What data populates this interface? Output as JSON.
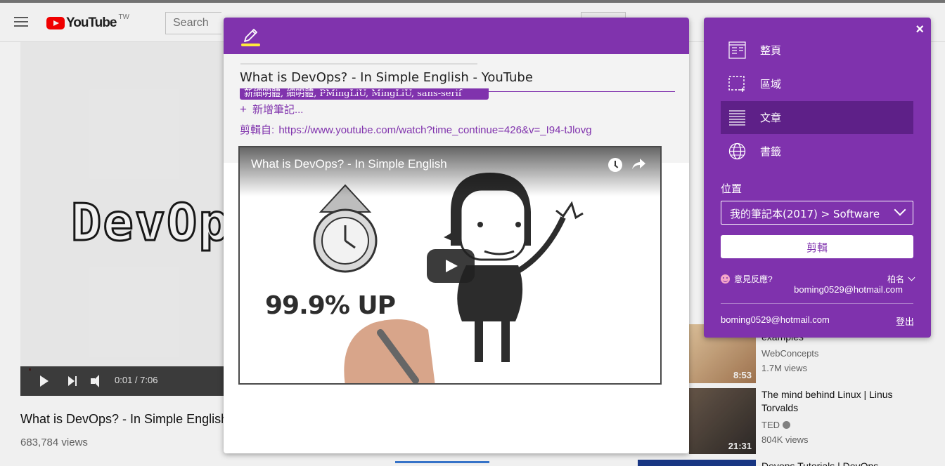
{
  "youtube": {
    "logo_text": "YouTube",
    "logo_region": "TW",
    "search_placeholder": "Search",
    "player": {
      "art_text": "DevOp",
      "time": "0:01 / 7:06",
      "progress_fraction": 0.0023
    },
    "video_title": "What is DevOps? - In Simple English",
    "views": "683,784 views",
    "related": [
      {
        "title": "examples",
        "channel": "WebConcepts",
        "views": "1.7M views",
        "duration": "8:53"
      },
      {
        "title": "The mind behind Linux | Linus Torvalds",
        "channel": "TED",
        "views": "804K views",
        "duration": "21:31"
      },
      {
        "title": "Devops Tutorials | DevOps",
        "channel": "",
        "views": "",
        "duration": ""
      }
    ]
  },
  "clipper_preview": {
    "page_title": "What is DevOps? - In Simple English - YouTube",
    "tooltip_text": "新細明體, 細明體, PMingLiU, MingLiU, sans-serif",
    "add_note": "新增筆記...",
    "source_label": "剪輯自:",
    "source_url": "https://www.youtube.com/watch?time_continue=426&v=_I94-tJlovg",
    "embed": {
      "title": "What is DevOps? - In Simple English",
      "uptime_text": "99.9% UP"
    }
  },
  "clipper_sidebar": {
    "close_label": "×",
    "modes": [
      {
        "label": "整頁",
        "icon": "full-page-icon",
        "selected": false
      },
      {
        "label": "區域",
        "icon": "region-icon",
        "selected": false
      },
      {
        "label": "文章",
        "icon": "article-icon",
        "selected": true
      },
      {
        "label": "書籤",
        "icon": "bookmark-globe-icon",
        "selected": false
      }
    ],
    "location_label": "位置",
    "location_value": "我的筆記本(2017) > Software",
    "clip_button": "剪輯",
    "feedback_label": "意見反應?",
    "user_name": "柏名",
    "user_email": "boming0529@hotmail.com",
    "footer_email": "boming0529@hotmail.com",
    "logout_label": "登出"
  },
  "colors": {
    "onenote_purple": "#7f32ad",
    "onenote_selected": "#5e2088",
    "highlight_yellow": "#ffeb3b",
    "youtube_red": "#ff0000"
  }
}
